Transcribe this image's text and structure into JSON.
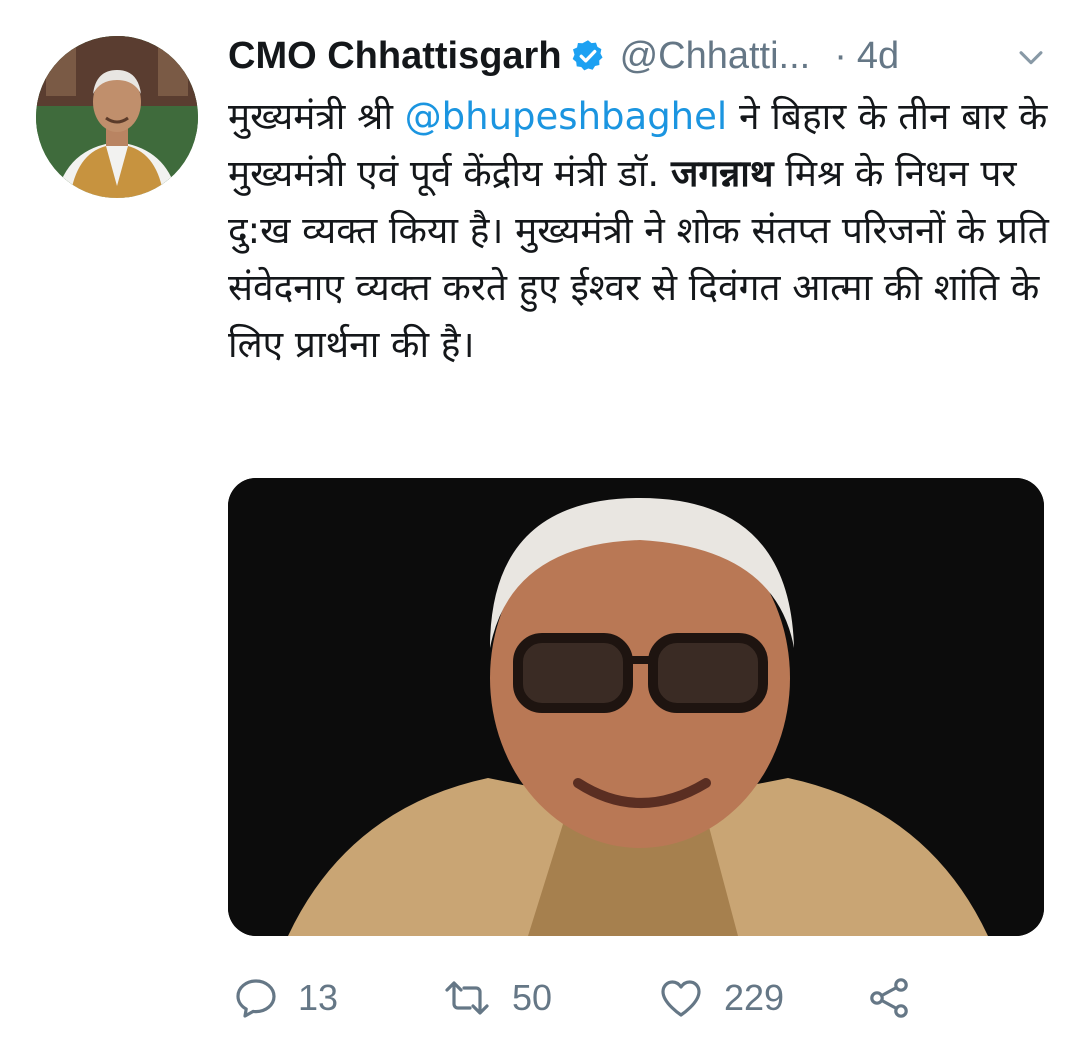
{
  "tweet": {
    "author_name": "CMO Chhattisgarh",
    "author_handle": "@Chhatti...",
    "separator": "·",
    "timestamp": "4d",
    "text": {
      "prefix": "मुख्यमंत्री श्री ",
      "mention": "@bhupeshbaghel",
      "middle": " ने बिहार के तीन बार के मुख्यमंत्री एवं पूर्व केंद्रीय मंत्री डॉ. ",
      "bold_name": "जगन्नाथ",
      "suffix": " मिश्र के निधन पर दु:ख व्यक्त किया है। मुख्यमंत्री ने शोक संतप्त परिजनों के प्रति संवेदनाए व्यक्त करते हुए ईश्वर से दिवंगत आत्मा की शांति के लिए प्रार्थना की है।"
    },
    "counts": {
      "replies": "13",
      "retweets": "50",
      "likes": "229"
    }
  },
  "icons": {
    "verified": "verified-badge-icon",
    "more": "chevron-down-icon",
    "reply": "reply-icon",
    "retweet": "retweet-icon",
    "like": "heart-icon",
    "share": "share-icon"
  },
  "colors": {
    "link": "#1b95e0",
    "secondary": "#657786",
    "verified": "#1da1f2"
  }
}
